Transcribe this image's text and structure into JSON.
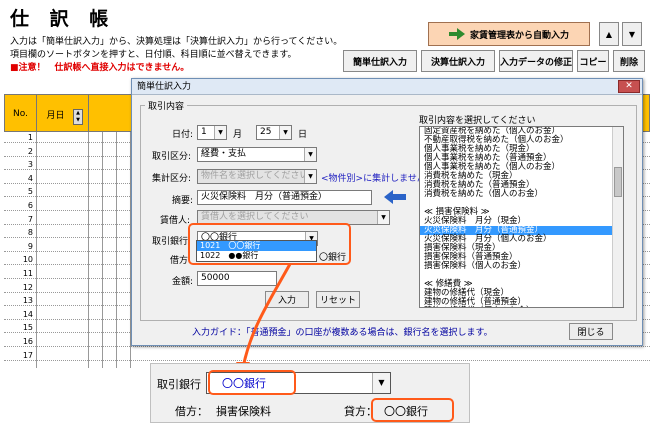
{
  "sheet": {
    "title": "仕 訳 帳",
    "note_line1": "入力は「簡単仕訳入力」から、決算処理は「決算仕訳入力」から行ってください。",
    "note_line2": "項目欄のソートボタンを押すと、日付順、科目順に並べ替えできます。",
    "note_line3": "■注意！　仕訳帳へ直接入力はできません。",
    "auto_entry_button": "家賃管理表から自動入力",
    "up_button": "▲",
    "down_button": "▼",
    "buttons": {
      "simple_entry": "簡単仕訳入力",
      "closing_entry": "決算仕訳入力",
      "fix_data": "入力データの修正",
      "copy": "コピー",
      "delete": "削除"
    },
    "headers": {
      "no": "No.",
      "day": "月日"
    },
    "row_numbers": [
      "1",
      "2",
      "3",
      "4",
      "5",
      "6",
      "7",
      "8",
      "9",
      "10",
      "11",
      "12",
      "13",
      "14",
      "15",
      "16",
      "17"
    ]
  },
  "dialog": {
    "title": "簡単仕訳入力",
    "close_x": "✕",
    "group_label": "取引内容",
    "date_label": "日付:",
    "month_value": "1",
    "month_unit": "月",
    "day_value": "25",
    "day_unit": "日",
    "category_label": "取引区分:",
    "category_value": "経費・支払",
    "aggregate_label": "集計区分:",
    "aggregate_placeholder": "物件名を選択してください",
    "aggregate_hint": "<物件別>に集計しません",
    "summary_label": "摘要:",
    "summary_value": "火災保険料　月分（普通預金）",
    "tenant_label": "賃借人:",
    "tenant_placeholder": "賃借人を選択してください",
    "bank_label": "取引銀行",
    "bank_value": "〇〇銀行",
    "bank_options": [
      "1021　〇〇銀行",
      "1022　●●銀行"
    ],
    "debit_label": "借方",
    "credit_partial": "〇銀行",
    "amount_label": "金額:",
    "amount_value": "50000",
    "input_button": "入力",
    "reset_button": "リセット",
    "list_caption": "取引内容を選択してください",
    "list_items": [
      "固定資産税を納めた（個人のお金）",
      "不動産取得税を納めた（個人のお金）",
      "個人事業税を納めた（現金）",
      "個人事業税を納めた（普通預金）",
      "個人事業税を納めた（個人のお金）",
      "消費税を納めた（現金）",
      "消費税を納めた（普通預金）",
      "消費税を納めた（個人のお金）",
      "",
      "≪ 損害保険料 ≫",
      "火災保険料　月分（現金）",
      "火災保険料　月分（普通預金）",
      "火災保険料　月分（個人のお金）",
      "損害保険料（現金）",
      "損害保険料（普通預金）",
      "損害保険料（個人のお金）",
      "",
      "≪ 修繕費 ≫",
      "建物の修繕代（現金）",
      "建物の修繕代（普通預金）",
      "建物の修繕代（個人のお金）",
      "建物付属設備の修理代（現金）"
    ],
    "selected_index": 11,
    "guide": "入力ガイド：「普通預金」の口座が複数ある場合は、銀行名を選択します。",
    "close_button": "閉じる"
  },
  "zoom": {
    "bank_label": "取引銀行",
    "bank_value": "〇〇銀行",
    "debit_label": "借方：",
    "debit_value": "損害保険料",
    "credit_label": "貸方：",
    "credit_value": "〇〇銀行"
  },
  "colors": {
    "highlight": "#ff5a1a",
    "header_fill": "#ffc000",
    "selection": "#3399ff"
  }
}
